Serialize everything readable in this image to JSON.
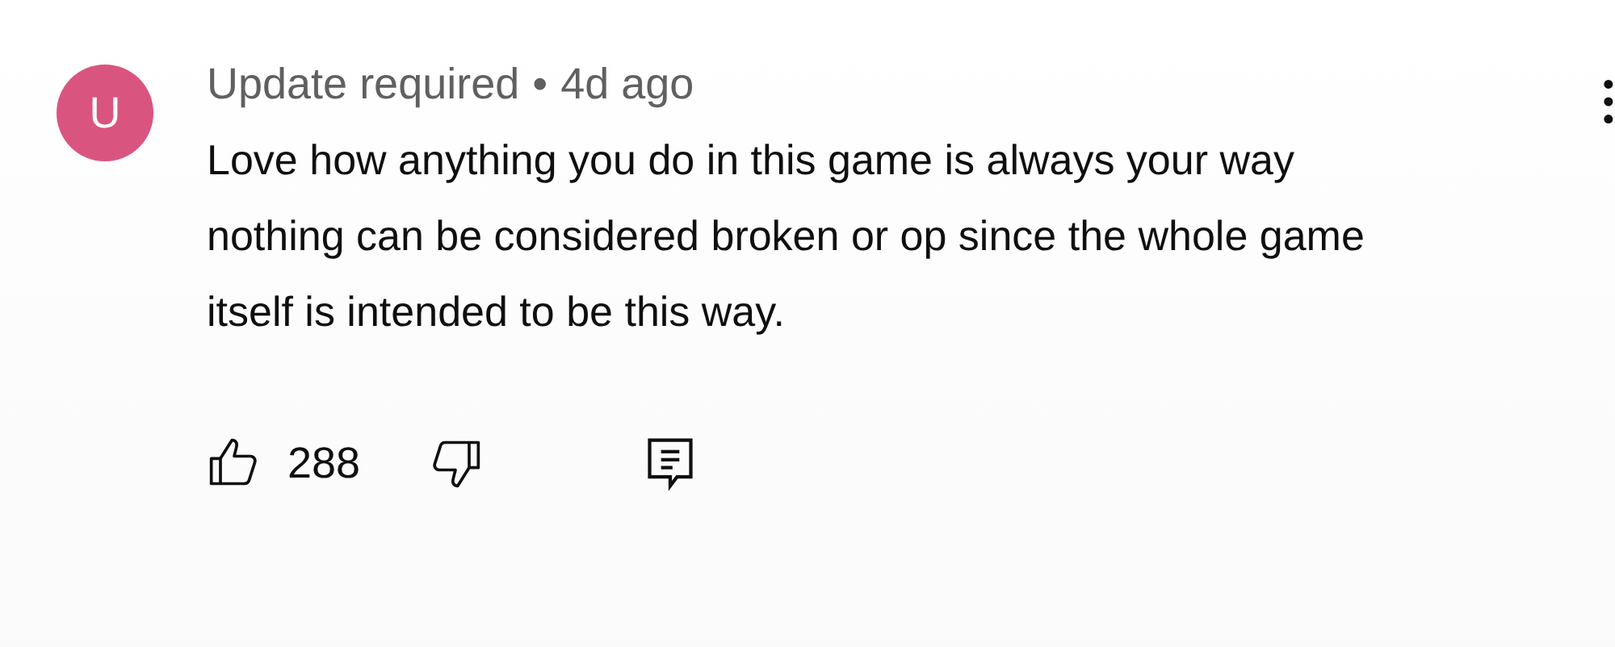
{
  "comment": {
    "avatar": "U",
    "author": "Update required",
    "separator": "•",
    "time": "4d ago",
    "text": "Love how anything you do in this game is always your way nothing can be considered broken or op since the whole game itself is intended to be this way.",
    "likes": "288"
  }
}
